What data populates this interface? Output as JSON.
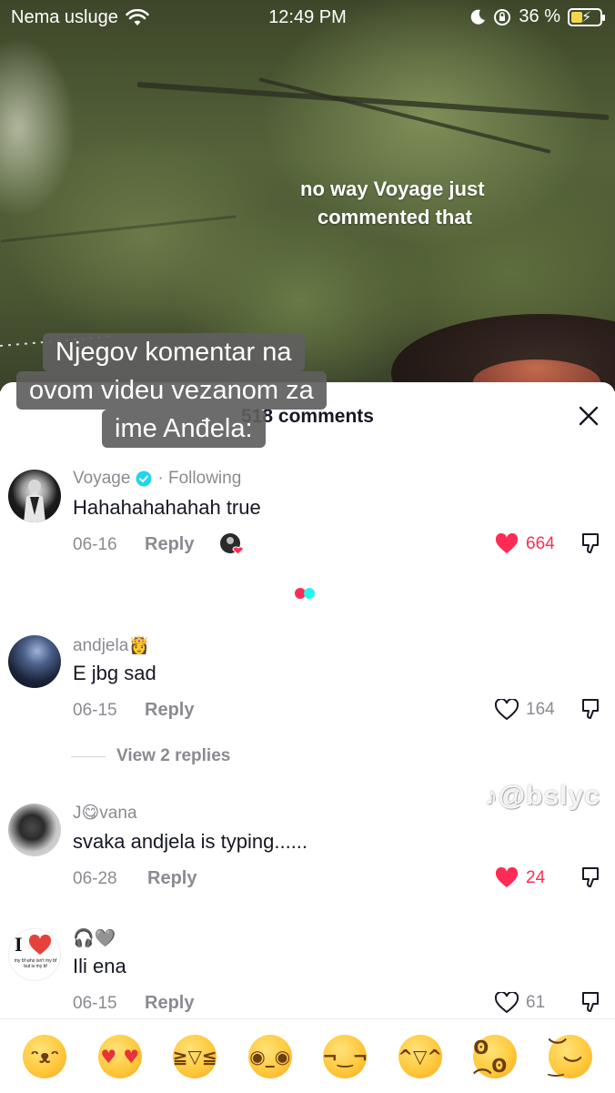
{
  "status_bar": {
    "carrier": "Nema usluge",
    "time": "12:49 PM",
    "battery_percent": "36 %",
    "battery_level": 0.36
  },
  "video": {
    "overlay_line1": "no way Voyage just",
    "overlay_line2": "commented that"
  },
  "caption": {
    "line1": "Njegov komentar na",
    "line2": "ovom videu vezanom za",
    "line3": "ime Anđela:"
  },
  "panel": {
    "title": "518 comments",
    "watermark": "@bslyc"
  },
  "comments": [
    {
      "username": "Voyage",
      "verified": true,
      "following": "· Following",
      "text": "Hahahahahahah true",
      "date": "06-16",
      "reply": "Reply",
      "likes": "664",
      "liked": true
    },
    {
      "username": "andjela👸",
      "text": "E jbg sad",
      "date": "06-15",
      "reply": "Reply",
      "likes": "164",
      "liked": false,
      "view_replies": "View 2 replies"
    },
    {
      "username": "J😋vana",
      "text": "svaka andjela is typing......",
      "date": "06-28",
      "reply": "Reply",
      "likes": "24",
      "liked": true
    },
    {
      "username": "🎧🩶",
      "text": "Ili ena",
      "date": "06-15",
      "reply": "Reply",
      "likes": "61",
      "liked": false,
      "avatar_text": "I",
      "avatar_subtext": "my bf who isn't my bf but is my bf"
    }
  ],
  "emoji_bar": [
    "grinning-face",
    "smiling-face-with-hearts",
    "tears-of-joy",
    "flushed-face",
    "smirking-face",
    "grinning-sweat",
    "pleading-face",
    "relieved-face"
  ],
  "colors": {
    "like_red": "#fe2c55",
    "muted_text": "#8a8b91",
    "primary_text": "#161823",
    "verified_blue": "#20d5ec",
    "loader_red": "#fe2c55",
    "loader_cyan": "#25f4ee"
  }
}
